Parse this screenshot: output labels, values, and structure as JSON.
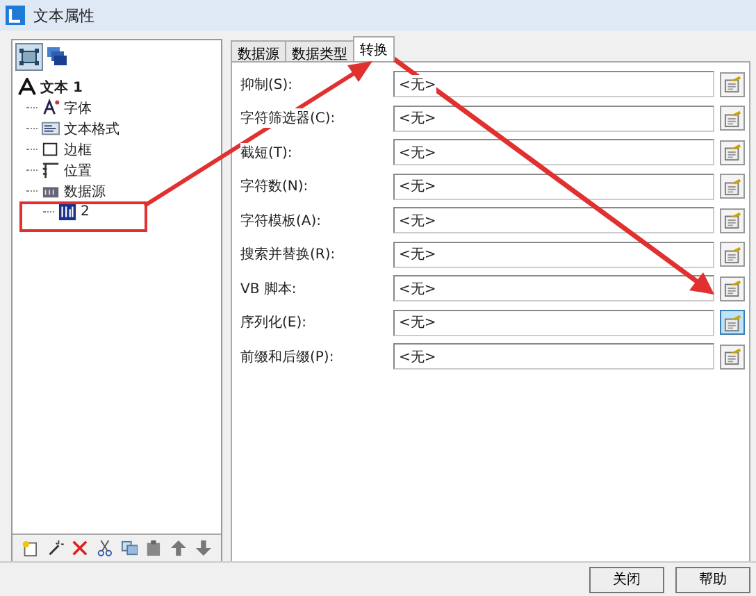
{
  "window": {
    "title": "文本属性"
  },
  "tree": {
    "label": "文本 1",
    "children": [
      {
        "label": "字体",
        "kind": "font"
      },
      {
        "label": "文本格式",
        "kind": "format"
      },
      {
        "label": "边框",
        "kind": "border"
      },
      {
        "label": "位置",
        "kind": "position"
      },
      {
        "label": "数据源",
        "kind": "datasource",
        "children": [
          {
            "label": "2",
            "kind": "data"
          }
        ]
      }
    ]
  },
  "tabs": [
    {
      "label": "数据源",
      "selected": false
    },
    {
      "label": "数据类型",
      "selected": false
    },
    {
      "label": "转换",
      "selected": true
    }
  ],
  "fields": [
    {
      "label": "抑制(S):",
      "value": "<无>",
      "hover": false
    },
    {
      "label": "字符筛选器(C):",
      "value": "<无>",
      "hover": false
    },
    {
      "label": "截短(T):",
      "value": "<无>",
      "hover": false
    },
    {
      "label": "字符数(N):",
      "value": "<无>",
      "hover": false
    },
    {
      "label": "字符模板(A):",
      "value": "<无>",
      "hover": false
    },
    {
      "label": "搜索并替换(R):",
      "value": "<无>",
      "hover": false
    },
    {
      "label": "VB 脚本:",
      "value": "<无>",
      "hover": false
    },
    {
      "label": "序列化(E):",
      "value": "<无>",
      "hover": true
    },
    {
      "label": "前缀和后缀(P):",
      "value": "<无>",
      "hover": false
    }
  ],
  "buttons": [
    "关闭",
    "帮助"
  ]
}
